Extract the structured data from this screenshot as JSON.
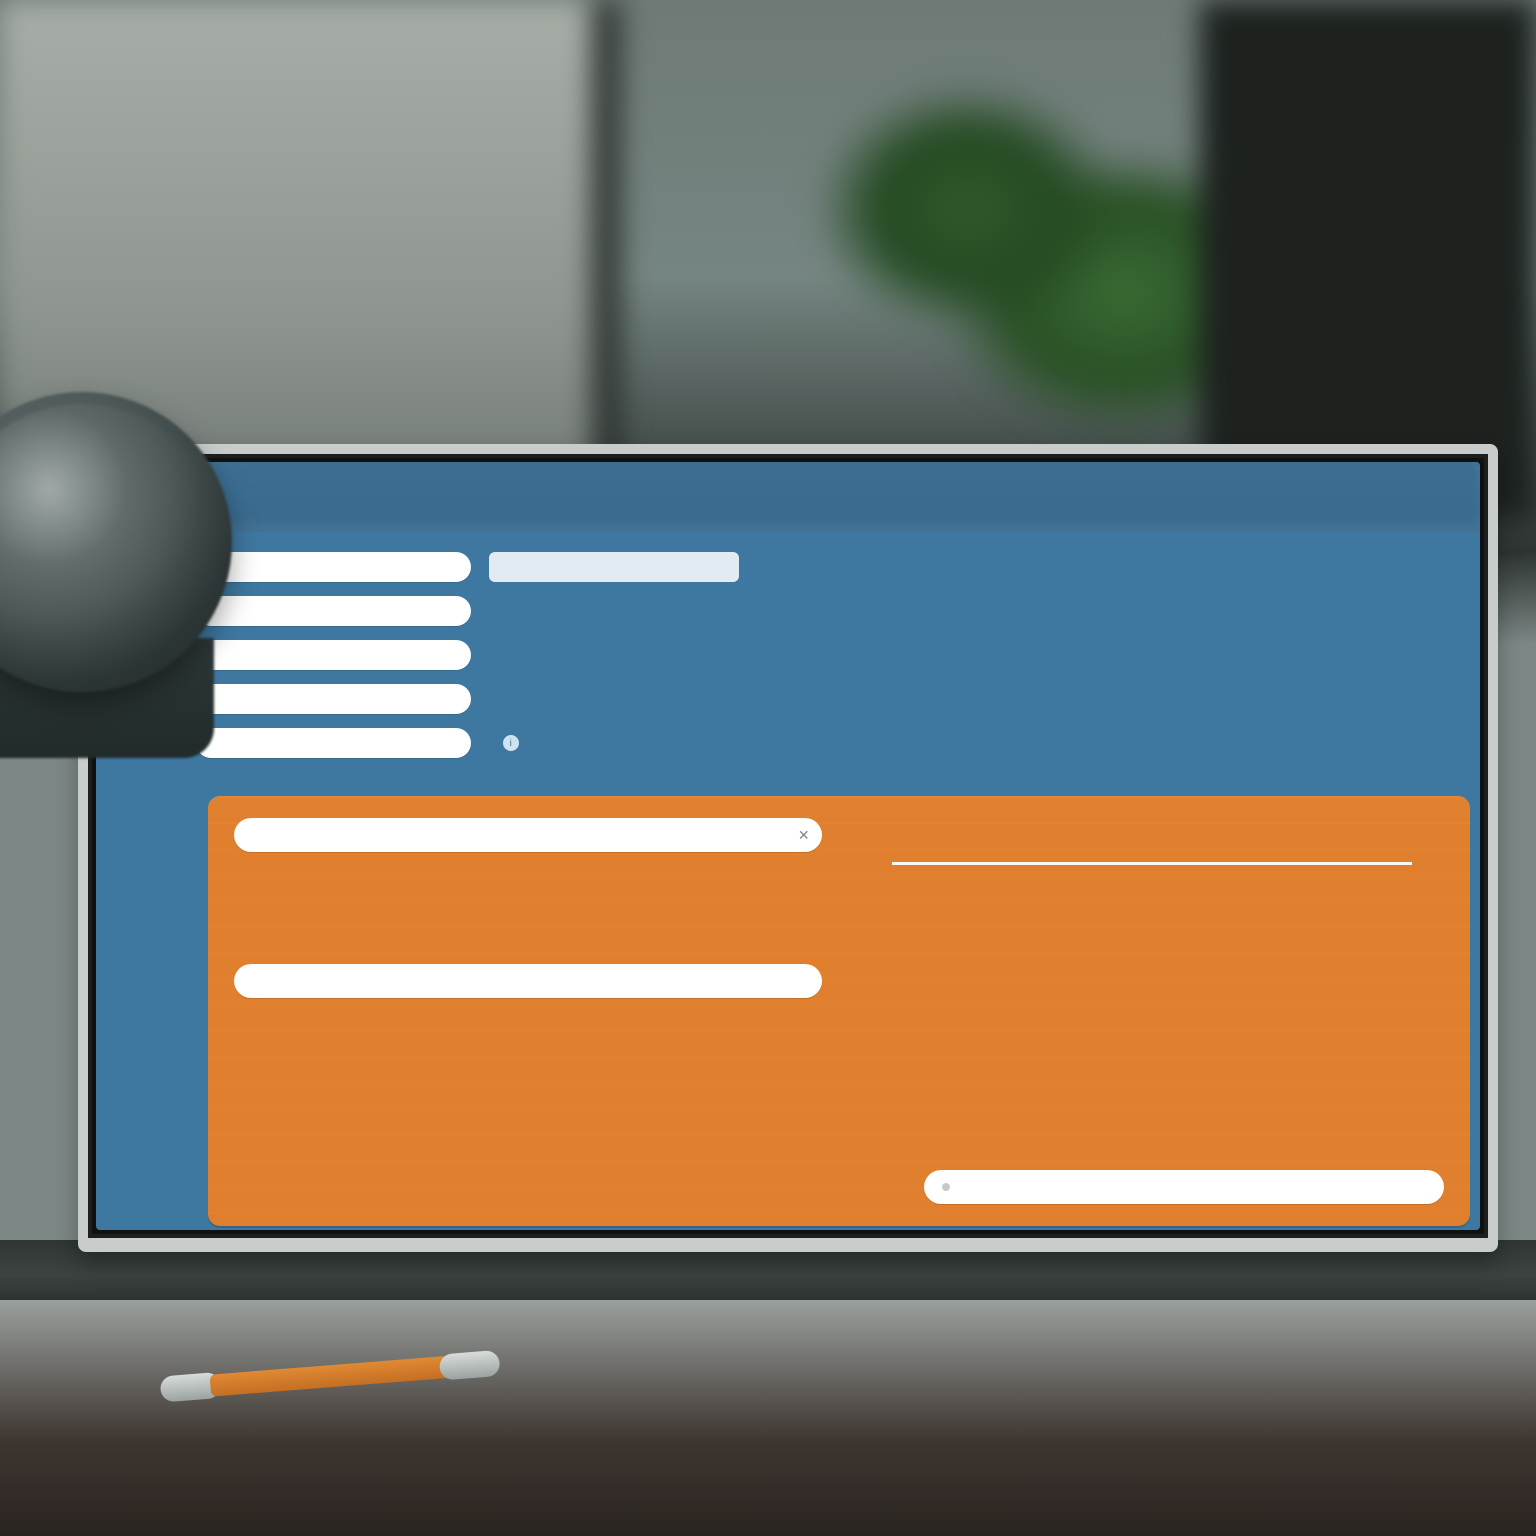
{
  "colors": {
    "screen_blue": "#3e78a0",
    "panel_orange": "#e07f2d",
    "pill_white": "#ffffff"
  },
  "menu": {
    "items": [
      {
        "label": ""
      },
      {
        "label": ""
      },
      {
        "label": ""
      },
      {
        "label": ""
      },
      {
        "label": ""
      }
    ]
  },
  "menu_values": {
    "items": [
      {
        "label": "",
        "style": "white"
      },
      {
        "label": ""
      },
      {
        "label": ""
      },
      {
        "label": ""
      },
      {
        "label": "",
        "has_icon": true
      }
    ]
  },
  "panel": {
    "field1_label": "",
    "field2_label": "",
    "status_label": ""
  }
}
